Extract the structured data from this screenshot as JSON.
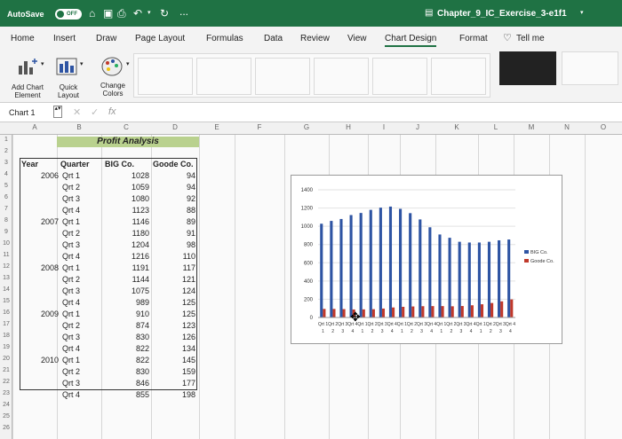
{
  "titlebar": {
    "autosave_label": "AutoSave",
    "autosave_state": "OFF",
    "more": "...",
    "file_title": "Chapter_9_IC_Exercise_3-e1f1"
  },
  "tabs": [
    "Home",
    "Insert",
    "Draw",
    "Page Layout",
    "Formulas",
    "Data",
    "Review",
    "View",
    "Chart Design",
    "Format"
  ],
  "active_tab": "Chart Design",
  "tell_me": "Tell me",
  "ribbon": {
    "add_chart_element": "Add Chart Element",
    "quick_layout": "Quick Layout",
    "change_colors": "Change Colors"
  },
  "formula_bar": {
    "name_box": "Chart 1",
    "fx": "fx",
    "value": ""
  },
  "columns": [
    "A",
    "B",
    "C",
    "D",
    "E",
    "F",
    "G",
    "H",
    "I",
    "J",
    "K",
    "L",
    "M",
    "N",
    "O"
  ],
  "rows": [
    "1",
    "2",
    "3",
    "4",
    "5",
    "6",
    "7",
    "8",
    "9",
    "10",
    "11",
    "12",
    "13",
    "14",
    "15",
    "16",
    "17",
    "18",
    "19",
    "20",
    "21",
    "22",
    "23",
    "24",
    "25",
    "26"
  ],
  "sheet": {
    "title": "Profit Analysis",
    "headers": [
      "Year",
      "Quarter",
      "BIG Co.",
      "Goode Co."
    ],
    "data": [
      [
        "2006",
        "Qrt 1",
        "1028",
        "94"
      ],
      [
        "",
        "Qrt 2",
        "1059",
        "94"
      ],
      [
        "",
        "Qrt 3",
        "1080",
        "92"
      ],
      [
        "",
        "Qrt 4",
        "1123",
        "88"
      ],
      [
        "2007",
        "Qrt 1",
        "1146",
        "89"
      ],
      [
        "",
        "Qrt 2",
        "1180",
        "91"
      ],
      [
        "",
        "Qrt 3",
        "1204",
        "98"
      ],
      [
        "",
        "Qrt 4",
        "1216",
        "110"
      ],
      [
        "2008",
        "Qrt 1",
        "1191",
        "117"
      ],
      [
        "",
        "Qrt 2",
        "1144",
        "121"
      ],
      [
        "",
        "Qrt 3",
        "1075",
        "124"
      ],
      [
        "",
        "Qrt 4",
        "989",
        "125"
      ],
      [
        "2009",
        "Qrt 1",
        "910",
        "125"
      ],
      [
        "",
        "Qrt 2",
        "874",
        "123"
      ],
      [
        "",
        "Qrt 3",
        "830",
        "126"
      ],
      [
        "",
        "Qrt 4",
        "822",
        "134"
      ],
      [
        "2010",
        "Qrt 1",
        "822",
        "145"
      ],
      [
        "",
        "Qrt 2",
        "830",
        "159"
      ],
      [
        "",
        "Qrt 3",
        "846",
        "177"
      ],
      [
        "",
        "Qrt 4",
        "855",
        "198"
      ]
    ]
  },
  "chart_data": {
    "type": "bar",
    "categories": [
      "Qrt 1",
      "Qrt 2",
      "Qrt 3",
      "Qrt 4",
      "Qrt 1",
      "Qrt 2",
      "Qrt 3",
      "Qrt 4",
      "Qrt 1",
      "Qrt 2",
      "Qrt 3",
      "Qrt 4",
      "Qrt 1",
      "Qrt 2",
      "Qrt 3",
      "Qrt 4",
      "Qrt 1",
      "Qrt 2",
      "Qrt 3",
      "Qrt 4"
    ],
    "category_numbers": [
      "1",
      "2",
      "3",
      "4",
      "1",
      "2",
      "3",
      "4",
      "1",
      "2",
      "3",
      "4",
      "1",
      "2",
      "3",
      "4",
      "1",
      "2",
      "3",
      "4"
    ],
    "series": [
      {
        "name": "BIG Co.",
        "color": "#2e54a3",
        "values": [
          1028,
          1059,
          1080,
          1123,
          1146,
          1180,
          1204,
          1216,
          1191,
          1144,
          1075,
          989,
          910,
          874,
          830,
          822,
          822,
          830,
          846,
          855
        ]
      },
      {
        "name": "Goode Co.",
        "color": "#c0392b",
        "values": [
          94,
          94,
          92,
          88,
          89,
          91,
          98,
          110,
          117,
          121,
          124,
          125,
          125,
          123,
          126,
          134,
          145,
          159,
          177,
          198
        ]
      }
    ],
    "ylim": [
      0,
      1400
    ],
    "yticks": [
      0,
      200,
      400,
      600,
      800,
      1000,
      1200,
      1400
    ],
    "legend_position": "right",
    "grid": true
  }
}
